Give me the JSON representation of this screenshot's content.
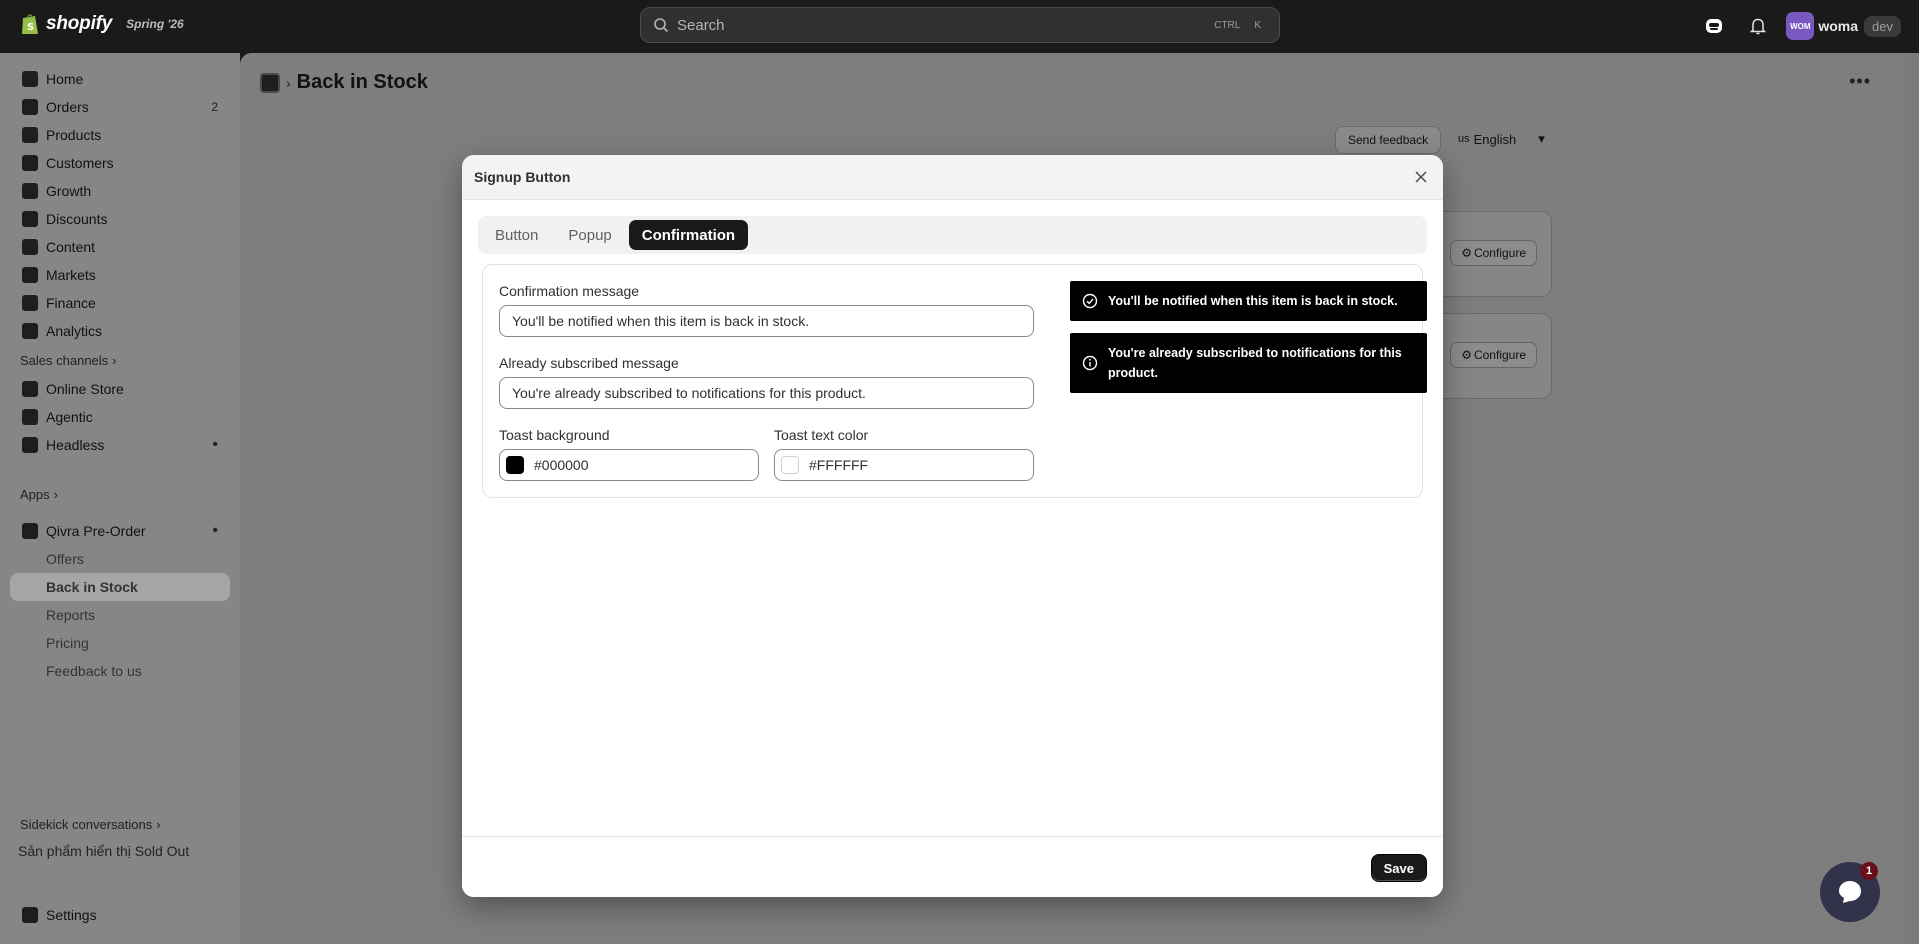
{
  "topbar": {
    "brand": "shopify",
    "edition": "Spring '26",
    "search_placeholder": "Search",
    "shortcut_ctrl": "CTRL",
    "shortcut_k": "K",
    "avatar_initials": "WOM",
    "username": "woma",
    "env": "dev"
  },
  "sidebar": {
    "items": [
      {
        "label": "Home"
      },
      {
        "label": "Orders",
        "count": "2"
      },
      {
        "label": "Products"
      },
      {
        "label": "Customers"
      },
      {
        "label": "Growth"
      },
      {
        "label": "Discounts"
      },
      {
        "label": "Content"
      },
      {
        "label": "Markets"
      },
      {
        "label": "Finance"
      },
      {
        "label": "Analytics"
      }
    ],
    "sales_channels_title": "Sales channels",
    "channels": [
      {
        "label": "Online Store"
      },
      {
        "label": "Agentic"
      },
      {
        "label": "Headless"
      }
    ],
    "apps_title": "Apps",
    "app_name": "Qivra Pre-Order",
    "app_subitems": [
      {
        "label": "Offers"
      },
      {
        "label": "Back in Stock"
      },
      {
        "label": "Reports"
      },
      {
        "label": "Pricing"
      },
      {
        "label": "Feedback to us"
      }
    ],
    "sidekick_title": "Sidekick conversations",
    "sidekick_item": "Sản phẩm hiển thị Sold Out",
    "settings": "Settings"
  },
  "main": {
    "page_title": "Back in Stock",
    "feedback_label": "Send feedback",
    "lang_prefix": "us",
    "language": "English",
    "configure_label": "Configure"
  },
  "modal": {
    "title": "Signup Button",
    "tabs": [
      {
        "label": "Button"
      },
      {
        "label": "Popup"
      },
      {
        "label": "Confirmation"
      }
    ],
    "active_tab": "Confirmation",
    "confirmation_label": "Confirmation message",
    "confirmation_value": "You'll be notified when this item is back in stock.",
    "already_label": "Already subscribed message",
    "already_value": "You're already subscribed to notifications for this product.",
    "toast_bg_label": "Toast background",
    "toast_bg_value": "#000000",
    "toast_text_label": "Toast text color",
    "toast_text_value": "#FFFFFF",
    "preview_success": "You'll be notified when this item is back in stock.",
    "preview_info": "You're already subscribed to notifications for this product.",
    "save_label": "Save"
  },
  "chat": {
    "badge": "1"
  },
  "colors": {
    "toast_background": "#000000",
    "toast_text": "#FFFFFF",
    "primary_button": "#1a1a1a"
  }
}
